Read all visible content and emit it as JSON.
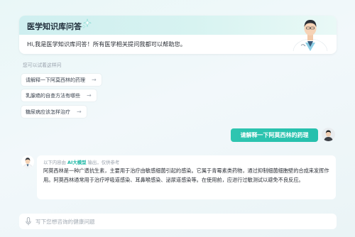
{
  "header": {
    "title": "医学知识库问答",
    "greeting": "Hi,我是医学知识库问答！所有医学相关提问我都可以帮助您。"
  },
  "suggestions": {
    "hint": "您可以试着这样问",
    "items": [
      {
        "label": "请解释一下阿莫西林的药理",
        "icon": "arrow-right-icon"
      },
      {
        "label": "乳腺癌的自查方法有哪些",
        "icon": "arrow-right-icon"
      },
      {
        "label": "糖尿病应该怎样治疗",
        "icon": "arrow-right-icon"
      }
    ]
  },
  "conversation": {
    "user_message": "请解释一下阿莫西林的药理",
    "answer": {
      "meta_prefix": "以下内容由",
      "meta_brand": "AI大模型",
      "meta_suffix": "输出，仅供参考",
      "text": "阿莫西林是一种广谱抗生素，主要用于治疗由敏感细菌引起的感染。它属于青霉素类药物，通过抑制细菌细胞壁的合成来发挥作用。阿莫西林通常用于治疗呼吸道感染、耳鼻喉感染、泌尿道感染等。在使用前，应进行过敏测试以避免不良反应。"
    }
  },
  "input": {
    "placeholder": "写下您想咨询的健康问题",
    "value": ""
  },
  "colors": {
    "accent": "#26c0ad",
    "header_band": "#d7f3f1",
    "background": "#eaf4f6"
  }
}
